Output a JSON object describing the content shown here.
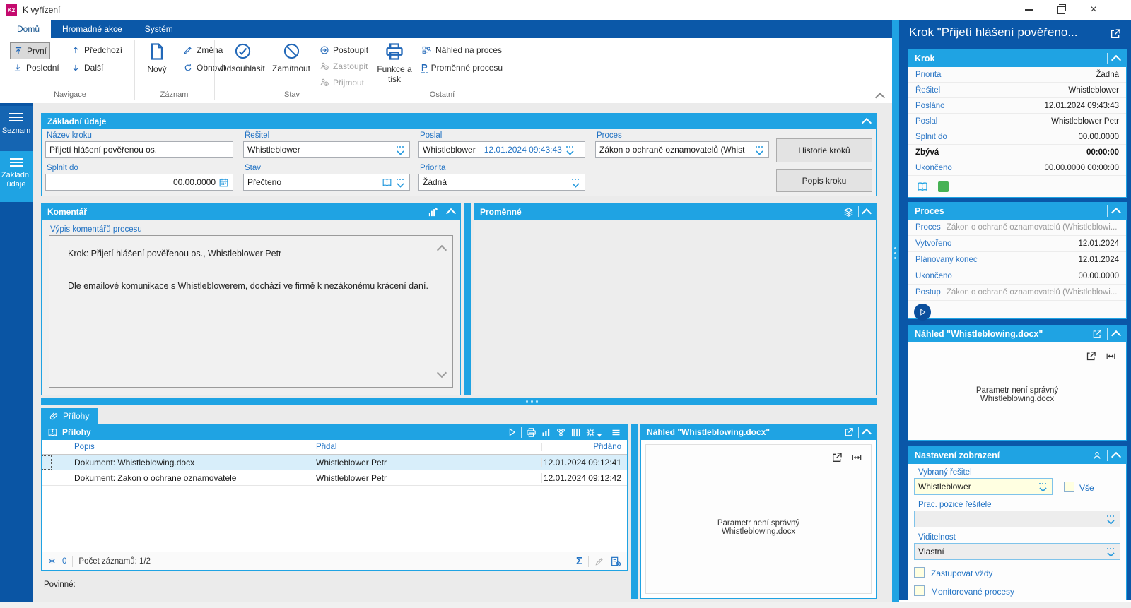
{
  "window": {
    "title": "K vyřízení",
    "app_badge": "K2"
  },
  "colors": {
    "accent_cyan": "#1fa3e3",
    "dark_blue": "#0b58a8",
    "selected_row": "#d8eefa",
    "input_yellow": "#ffffe1",
    "status_green": "#47b254",
    "label_blue": "#2273c4",
    "icon_blue": "#2268b8"
  },
  "ribbon": {
    "tabs": [
      {
        "label": "Domů",
        "active": true
      },
      {
        "label": "Hromadné akce",
        "active": false
      },
      {
        "label": "Systém",
        "active": false
      }
    ],
    "navigace": {
      "group_label": "Navigace",
      "first": "První",
      "last": "Poslední",
      "prev": "Předchozí",
      "next": "Další"
    },
    "zaznam": {
      "group_label": "Záznam",
      "new": "Nový",
      "change": "Změna",
      "refresh": "Obnovit"
    },
    "stav": {
      "group_label": "Stav",
      "approve": "Odsouhlasit",
      "reject": "Zamítnout",
      "forward": "Postoupit",
      "substitute": "Zastoupit",
      "accept": "Přijmout"
    },
    "ostatni": {
      "group_label": "Ostatní",
      "functions_print": "Funkce a tisk",
      "process_preview": "Náhled na proces",
      "process_variables": "Proměnné procesu",
      "variables_letter": "P"
    }
  },
  "sidebar": {
    "items": [
      {
        "label": "Seznam"
      },
      {
        "label": "Základní údaje"
      }
    ]
  },
  "form": {
    "title": "Základní údaje",
    "nazev_kroku": {
      "label": "Název kroku",
      "value": "Přijetí hlášení pověřenou os."
    },
    "resitel": {
      "label": "Řešitel",
      "value": "Whistleblower"
    },
    "poslal": {
      "label": "Poslal",
      "value": "Whistleblower",
      "datetime": "12.01.2024 09:43:43"
    },
    "proces": {
      "label": "Proces",
      "value": "Zákon o ochraně oznamovatelů (Whist"
    },
    "splnit_do": {
      "label": "Splnit do",
      "value": "00.00.0000"
    },
    "stav": {
      "label": "Stav",
      "value": "Přečteno"
    },
    "priorita": {
      "label": "Priorita",
      "value": "Žádná"
    },
    "buttons": {
      "history": "Historie kroků",
      "description": "Popis kroku"
    }
  },
  "comment": {
    "title": "Komentář",
    "field_label": "Výpis komentářů procesu",
    "lines": [
      "Krok: Přijetí hlášení pověřenou os., Whistleblower Petr",
      "Dle emailové komunikace s Whistleblowerem, dochází ve firmě k nezákonému krácení daní."
    ]
  },
  "variables_panel": {
    "title": "Proměnné"
  },
  "attachments": {
    "tab_label": "Přílohy",
    "title": "Přílohy",
    "columns": [
      "Popis",
      "Přidal",
      "Přidáno"
    ],
    "rows": [
      {
        "popis": "Dokument: Whistleblowing.docx",
        "pridal": "Whistleblower Petr",
        "pridano": "12.01.2024 09:12:41",
        "selected": true
      },
      {
        "popis": "Dokument: Zakon o ochrane oznamovatele",
        "pridal": "Whistleblower Petr",
        "pridano": "12.01.2024 09:12:42",
        "selected": false
      }
    ],
    "footer": {
      "filter_count": "0",
      "records": "Počet záznamů: 1/2"
    },
    "required_label": "Povinné:"
  },
  "preview": {
    "title": "Náhled \"Whistleblowing.docx\"",
    "message_line1": "Parametr není správný",
    "message_line2": "Whistleblowing.docx"
  },
  "right_panel": {
    "title": "Krok \"Přijetí hlášení pověřeno...",
    "krok": {
      "title": "Krok",
      "rows": [
        {
          "label": "Priorita",
          "value": "Žádná"
        },
        {
          "label": "Řešitel",
          "value": "Whistleblower"
        },
        {
          "label": "Posláno",
          "value": "12.01.2024 09:43:43"
        },
        {
          "label": "Poslal",
          "value": "Whistleblower Petr"
        },
        {
          "label": "Splnit do",
          "value": "00.00.0000"
        },
        {
          "label": "Zbývá",
          "value": "00:00:00",
          "bold": true
        },
        {
          "label": "Ukončeno",
          "value": "00.00.0000 00:00:00"
        }
      ]
    },
    "proces": {
      "title": "Proces",
      "rows": [
        {
          "label": "Proces",
          "value": "Zákon o ochraně oznamovatelů (Whistleblowi...",
          "muted": true
        },
        {
          "label": "Vytvořeno",
          "value": "12.01.2024"
        },
        {
          "label": "Plánovaný konec",
          "value": "12.01.2024"
        },
        {
          "label": "Ukončeno",
          "value": "00.00.0000"
        },
        {
          "label": "Postup",
          "value": "Zákon o ochraně oznamovatelů (Whistleblowi...",
          "muted": true
        }
      ]
    },
    "nahled": {
      "title": "Náhled \"Whistleblowing.docx\""
    },
    "settings": {
      "title": "Nastavení zobrazení",
      "vybrany_resitel": {
        "label": "Vybraný řešitel",
        "value": "Whistleblower"
      },
      "vse_label": "Vše",
      "prac_pozice": {
        "label": "Prac. pozice řešitele",
        "value": ""
      },
      "viditelnost": {
        "label": "Viditelnost",
        "value": "Vlastní"
      },
      "zastupovat": "Zastupovat vždy",
      "monitorovane": "Monitorované procesy"
    }
  }
}
